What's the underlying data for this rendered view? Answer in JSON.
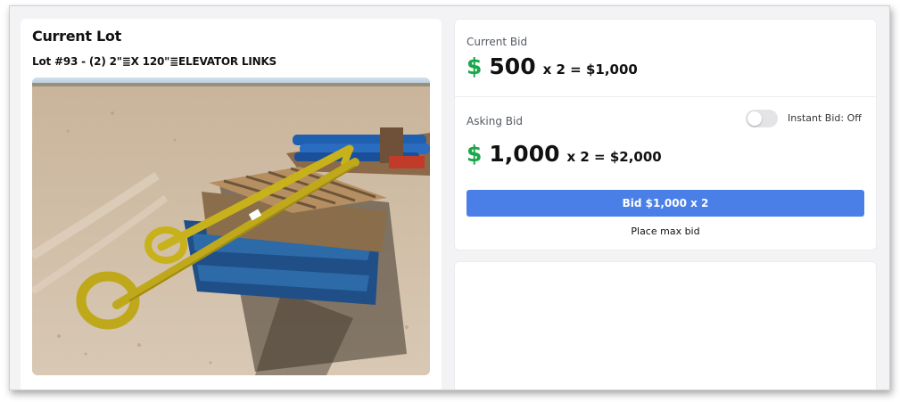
{
  "lot": {
    "heading": "Current Lot",
    "title": "Lot #93 - (2) 2\"≣X 120\"≣ELEVATOR LINKS",
    "image_subject": "yellow elevator links on pallets"
  },
  "current_bid": {
    "label": "Current Bid",
    "currency_symbol": "$",
    "amount": "500",
    "multiplier_text": "x 2 = $1,000"
  },
  "asking_bid": {
    "label": "Asking Bid",
    "currency_symbol": "$",
    "amount": "1,000",
    "multiplier_text": "x 2 = $2,000"
  },
  "instant_bid": {
    "label": "Instant Bid: Off",
    "enabled": false
  },
  "actions": {
    "bid_button_label": "Bid $1,000 x 2",
    "max_bid_label": "Place max bid"
  },
  "colors": {
    "accent_blue": "#4a7fe8",
    "dollar_green": "#1aa64b"
  }
}
